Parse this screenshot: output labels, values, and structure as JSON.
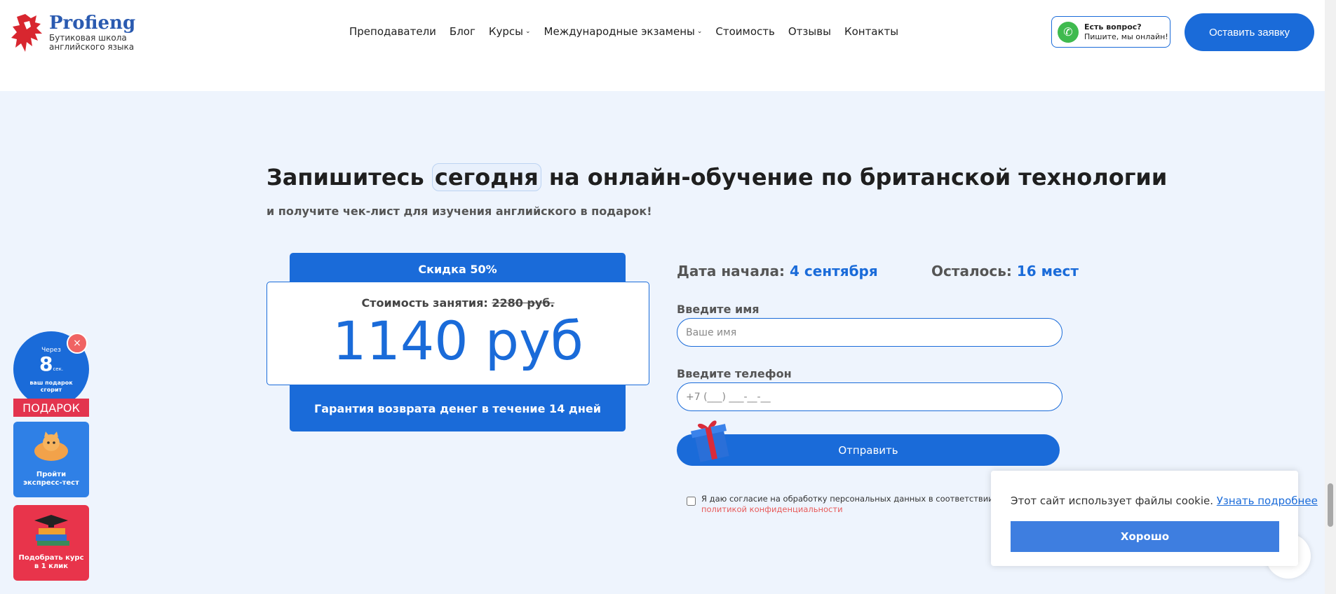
{
  "header": {
    "logo_name": "Profieng",
    "logo_sub_line1": "Бутиковая школа",
    "logo_sub_line2": "английского языка",
    "nav": [
      {
        "label": "Преподаватели"
      },
      {
        "label": "Блог"
      },
      {
        "label": "Курсы"
      },
      {
        "label": "Международные экзамены"
      },
      {
        "label": "Стоимость"
      },
      {
        "label": "Отзывы"
      },
      {
        "label": "Контакты"
      }
    ],
    "whatsapp_title": "Есть вопрос?",
    "whatsapp_sub": "Пишите, мы онлайн!",
    "lead_button": "Оставить заявку"
  },
  "hero": {
    "title_pre": "Запишитесь ",
    "title_highlight": "сегодня",
    "title_post": " на онлайн-обучение по британской технологии",
    "subtitle": "и получите чек-лист для изучения английского в подарок!"
  },
  "price": {
    "discount": "Скидка 50%",
    "label": "Стоимость занятия: ",
    "old_price": "2280 руб.",
    "new_price": "1140 руб",
    "guarantee": "Гарантия возврата денег в течение 14 дней"
  },
  "form": {
    "start_label": "Дата начала: ",
    "start_value": "4 сентября",
    "seats_label": "Осталось: ",
    "seats_value": "16 мест",
    "name_label": "Введите имя",
    "name_placeholder": "Ваше имя",
    "phone_label": "Введите телефон",
    "phone_placeholder": "+7 (___) ___-__-__",
    "submit": "Отправить",
    "consent_text": "Я даю согласие на обработку персональных данных в соответствии с ",
    "consent_link": "политикой конфиденциальности"
  },
  "widgets": {
    "timer_pre": "Через",
    "timer_value": "8",
    "timer_unit": "сек.",
    "timer_post_line1": "ваш подарок",
    "timer_post_line2": "сгорит",
    "timer_close": "×",
    "gift_tag": "ПОДАРОК",
    "test_line1": "Пройти",
    "test_line2": "экспресс-тест",
    "course_line1": "Подобрать курс",
    "course_line2": "в 1 клик"
  },
  "cookie": {
    "text": "Этот сайт использует файлы cookie. ",
    "link": "Узнать подробнее",
    "button": "Хорошо"
  },
  "colors": {
    "accent": "#1a6bd9",
    "background": "#eef4fd",
    "gift_red": "#e3344e",
    "whatsapp_green": "#3fba4f"
  }
}
